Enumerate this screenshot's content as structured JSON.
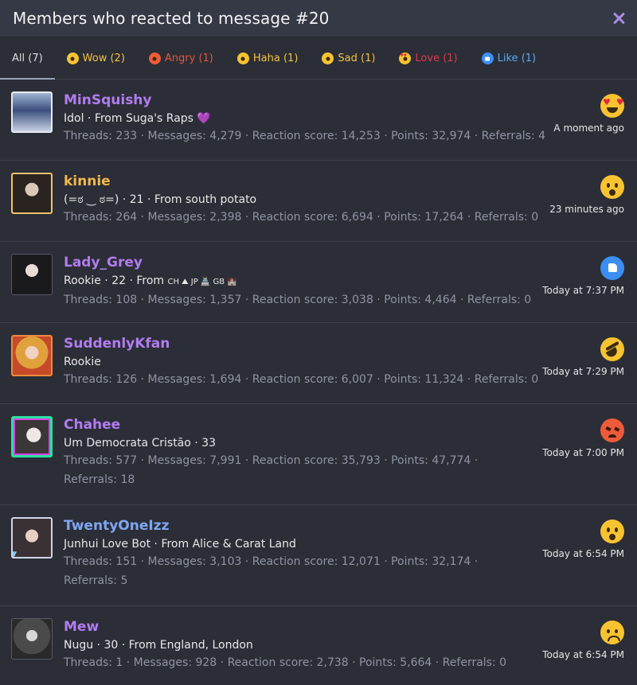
{
  "header": {
    "title": "Members who reacted to message #20"
  },
  "tabs": [
    {
      "label": "All (7)",
      "color": "#dcdcdc",
      "emoji": ""
    },
    {
      "label": "Wow (2)",
      "color": "#f4c242",
      "emoji": "wow"
    },
    {
      "label": "Angry (1)",
      "color": "#e2583e",
      "emoji": "angry"
    },
    {
      "label": "Haha (1)",
      "color": "#f4c242",
      "emoji": "haha"
    },
    {
      "label": "Sad (1)",
      "color": "#f4c242",
      "emoji": "sad"
    },
    {
      "label": "Love (1)",
      "color": "#e0394a",
      "emoji": "love"
    },
    {
      "label": "Like (1)",
      "color": "#5aa8f0",
      "emoji": "like"
    }
  ],
  "members": [
    {
      "name": "MinSquishy",
      "name_color": "#b27cf0",
      "blurb": "Idol · From Suga's Raps",
      "blurb_extra": "💜",
      "stats": "Threads: 233 · Messages: 4,279 · Reaction score: 14,253 · Points: 32,974 · Referrals: 4",
      "reaction": "love",
      "reaction_color": "#f7c331",
      "time": "A moment ago"
    },
    {
      "name": "kinnie",
      "name_color": "#f2b84a",
      "blurb": "(=ಠ ‿ ಠ=) · 21 · From south potato",
      "blurb_extra": "",
      "stats": "Threads: 264 · Messages: 2,398 · Reaction score: 6,694 · Points: 17,264 · Referrals: 0",
      "reaction": "wow",
      "reaction_color": "#f7c331",
      "time": "23 minutes ago"
    },
    {
      "name": "Lady_Grey",
      "name_color": "#b27cf0",
      "blurb": "Rookie · 22 · From",
      "blurb_extra": "CH ⛰ JP 🏯 GB 🏰",
      "stats": "Threads: 108 · Messages: 1,357 · Reaction score: 3,038 · Points: 4,464 · Referrals: 0",
      "reaction": "like",
      "reaction_color": "#3b8ff2",
      "time": "Today at 7:37 PM"
    },
    {
      "name": "SuddenlyKfan",
      "name_color": "#b27cf0",
      "blurb": "Rookie",
      "blurb_extra": "",
      "stats": "Threads: 126 · Messages: 1,694 · Reaction score: 6,007 · Points: 11,324 · Referrals: 0",
      "reaction": "haha",
      "reaction_color": "#f7c331",
      "time": "Today at 7:29 PM"
    },
    {
      "name": "Chahee",
      "name_color": "#b27cf0",
      "blurb": "Um Democrata Cristão · 33",
      "blurb_extra": "",
      "stats": "Threads: 577 · Messages: 7,991 · Reaction score: 35,793 · Points: 47,774 · Referrals: 18",
      "reaction": "angry",
      "reaction_color": "#ee5b3a",
      "time": "Today at 7:00 PM"
    },
    {
      "name": "TwentyOneIzz",
      "name_color": "#7fa6f0",
      "blurb": "Junhui Love Bot · From Alice & Carat Land",
      "blurb_extra": "",
      "stats": "Threads: 151 · Messages: 3,103 · Reaction score: 12,071 · Points: 32,174 · Referrals: 5",
      "reaction": "wow",
      "reaction_color": "#f7c331",
      "time": "Today at 6:54 PM"
    },
    {
      "name": "Mew",
      "name_color": "#b27cf0",
      "blurb": "Nugu · 30 · From England, London",
      "blurb_extra": "",
      "stats": "Threads: 1 · Messages: 928 · Reaction score: 2,738 · Points: 5,664 · Referrals: 0",
      "reaction": "sad",
      "reaction_color": "#f7c331",
      "time": "Today at 6:54 PM"
    }
  ]
}
